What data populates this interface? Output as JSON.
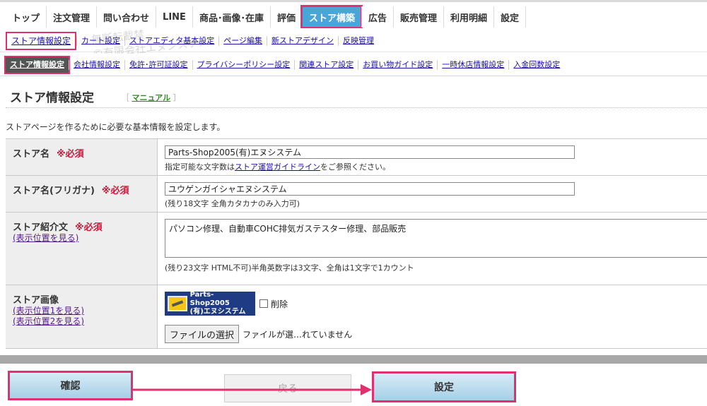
{
  "top_nav": {
    "tabs": [
      {
        "label": "トップ"
      },
      {
        "label": "注文管理"
      },
      {
        "label": "問い合わせ"
      },
      {
        "label": "LINE"
      },
      {
        "label": "商品･画像･在庫"
      },
      {
        "label": "評価"
      },
      {
        "label": "ストア構築",
        "active": true
      },
      {
        "label": "広告"
      },
      {
        "label": "販売管理"
      },
      {
        "label": "利用明細"
      },
      {
        "label": "設定"
      }
    ]
  },
  "sub_nav_1": {
    "items": [
      {
        "label": "ストア情報設定",
        "active": true
      },
      {
        "label": "カート設定"
      },
      {
        "label": "ストアエディタ基本設定"
      },
      {
        "label": "ページ編集"
      },
      {
        "label": "新ストアデザイン"
      },
      {
        "label": "反映管理"
      }
    ]
  },
  "sub_nav_2": {
    "items": [
      {
        "label": "ストア情報設定",
        "active": true
      },
      {
        "label": "会社情報設定"
      },
      {
        "label": "免許･許可証設定"
      },
      {
        "label": "プライバシーポリシー設定"
      },
      {
        "label": "関連ストア設定"
      },
      {
        "label": "お買い物ガイド設定"
      },
      {
        "label": "一時休店情報設定"
      },
      {
        "label": "入金回数設定"
      }
    ]
  },
  "watermark": {
    "line1": "無断転載禁",
    "line2": "©有限会社エヌシステム"
  },
  "page": {
    "title": "ストア情報設定",
    "manual_open": "［",
    "manual_link": "マニュアル",
    "manual_close": "］",
    "description": "ストアページを作るために必要な基本情報を設定します。"
  },
  "form": {
    "store_name": {
      "label": "ストア名",
      "required": "※必須",
      "value": "Parts-Shop2005(有)エヌシステム",
      "hint_before": "指定可能な文字数は",
      "hint_link": "ストア運営ガイドライン",
      "hint_after": "をご参照ください。"
    },
    "store_kana": {
      "label": "ストア名(フリガナ)",
      "required": "※必須",
      "value": "ユウゲンガイシャエヌシステム",
      "hint": "(残り18文字 全角カタカナのみ入力可)"
    },
    "store_intro": {
      "label": "ストア紹介文",
      "required": "※必須",
      "sublink": "(表示位置を見る)",
      "value": "パソコン修理、自動車COHC排気ガステスター修理、部品販売",
      "hint": "(残り23文字 HTML不可)半角英数字は3文字、全角は1文字で1カウント"
    },
    "store_image": {
      "label": "ストア画像",
      "sublink1": "(表示位置1を見る)",
      "sublink2": "(表示位置2を見る)",
      "logo_line1": "Parts-Shop2005",
      "logo_line2": "(有)エヌシステム",
      "delete_label": "削除",
      "file_button": "ファイルの選択",
      "file_status": "ファイルが選…れていません"
    }
  },
  "buttons": {
    "confirm": "確認",
    "back": "戻る",
    "set": "設定"
  },
  "colors": {
    "accent_tab": "#4aa6d9",
    "highlight": "#e0306f",
    "required": "#d0143a"
  }
}
